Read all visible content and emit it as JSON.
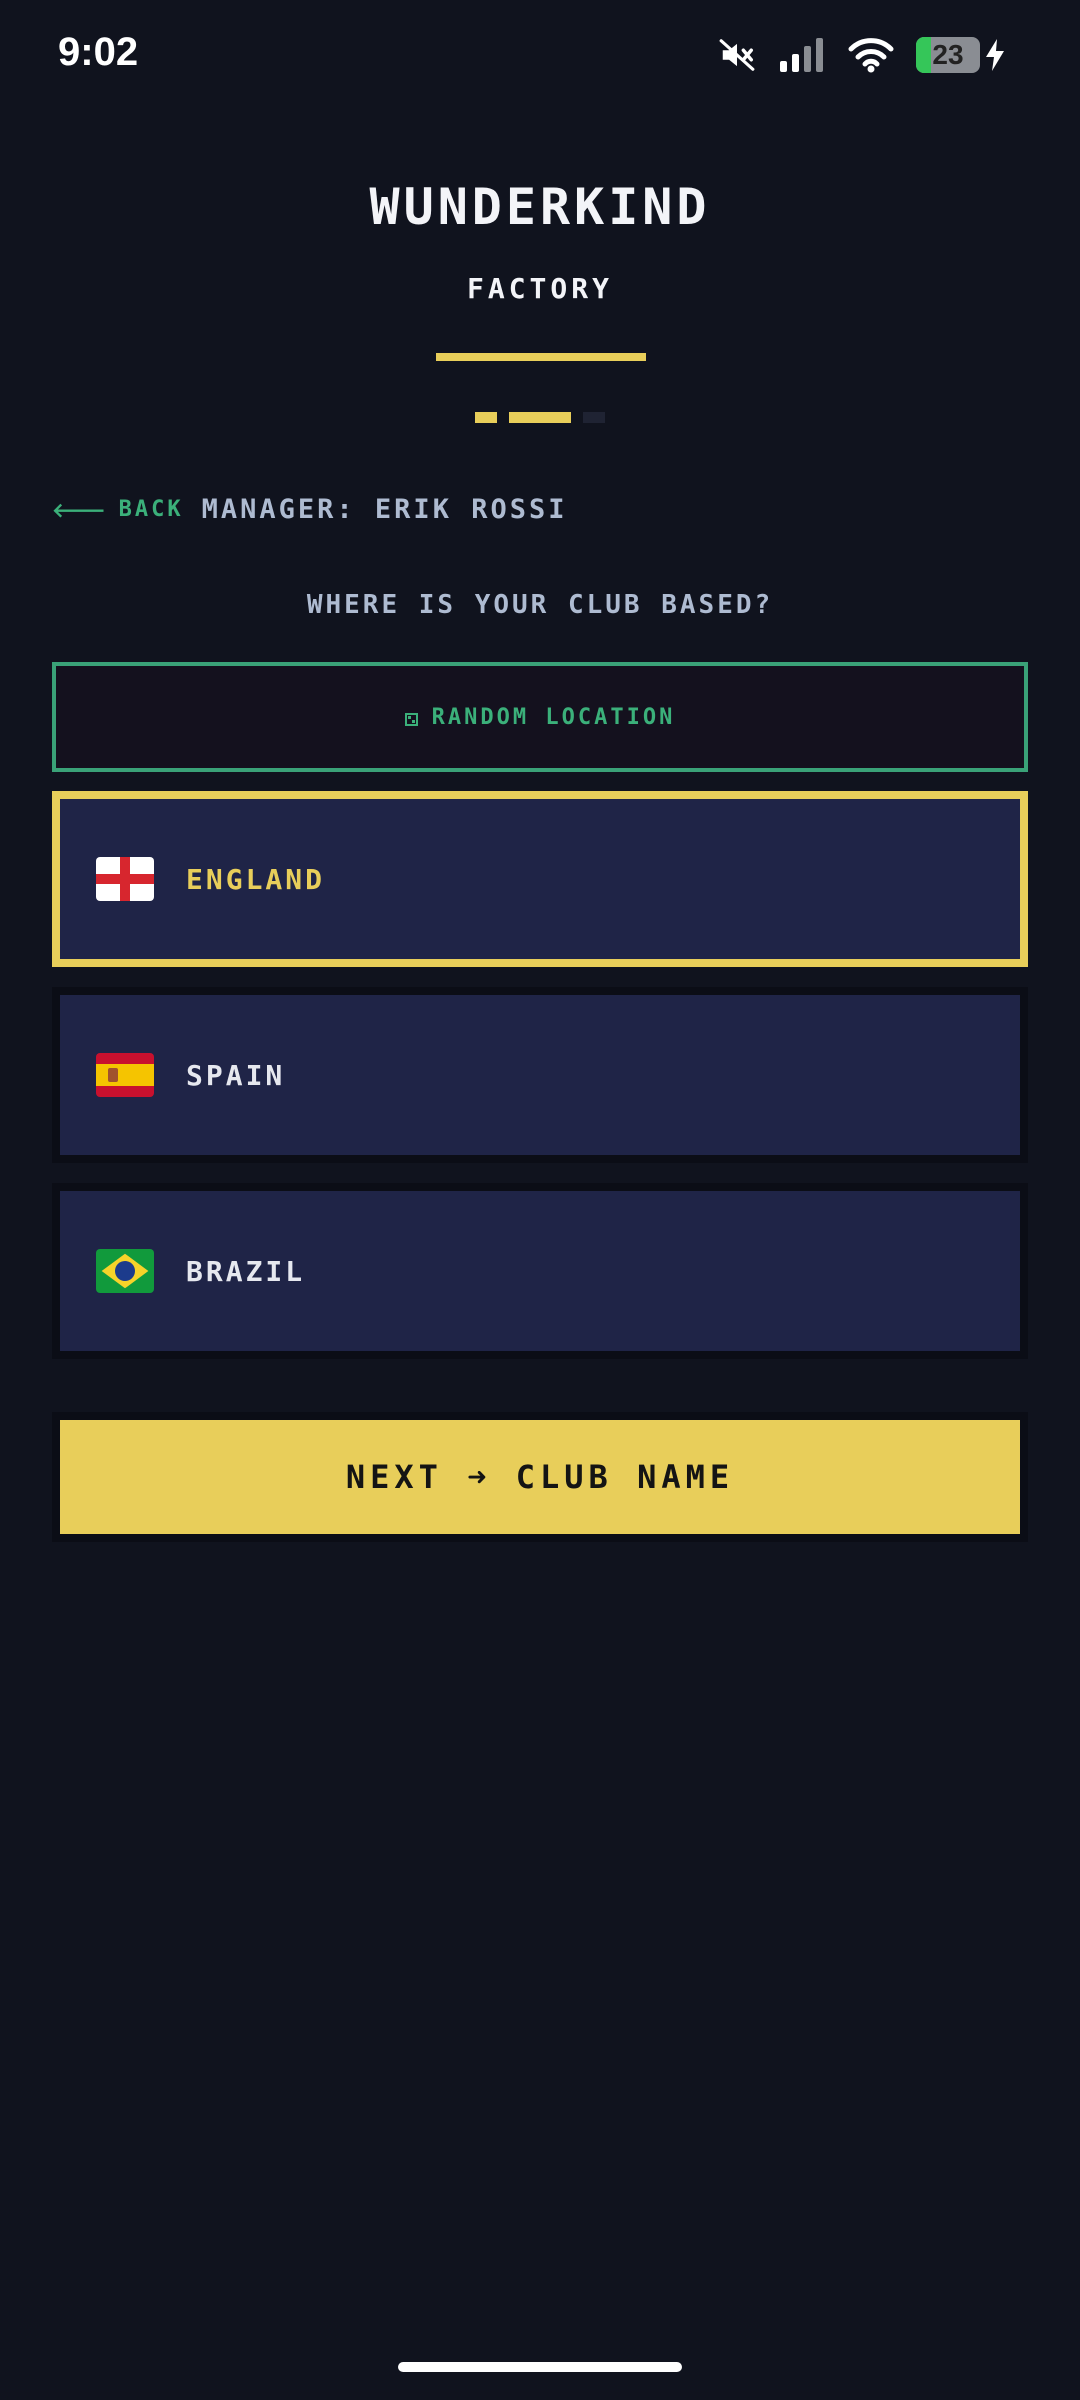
{
  "status_bar": {
    "time": "9:02",
    "battery_percent": 23,
    "battery_text": "23",
    "icons": [
      "mute-icon",
      "signal-icon",
      "wifi-icon",
      "battery-icon",
      "charging-icon"
    ]
  },
  "header": {
    "title": "WUNDERKIND",
    "subtitle": "FACTORY",
    "steps": [
      "done",
      "active",
      "todo"
    ]
  },
  "nav": {
    "back_arrow": "🡐",
    "back_label": "BACK",
    "manager_label": "MANAGER: ERIK ROSSI"
  },
  "question": "WHERE IS YOUR CLUB BASED?",
  "random_button": {
    "icon": "dice-icon",
    "label": "RANDOM LOCATION"
  },
  "countries": [
    {
      "label": "ENGLAND",
      "flag": "england-flag-icon",
      "selected": true
    },
    {
      "label": "SPAIN",
      "flag": "spain-flag-icon",
      "selected": false
    },
    {
      "label": "BRAZIL",
      "flag": "brazil-flag-icon",
      "selected": false
    }
  ],
  "next_button": {
    "label": "NEXT ➜ CLUB NAME"
  },
  "colors": {
    "background": "#10131e",
    "accent": "#e8ce5a",
    "green": "#3bb07a",
    "card": "#1f2447",
    "muted_text": "#aebbd1"
  }
}
